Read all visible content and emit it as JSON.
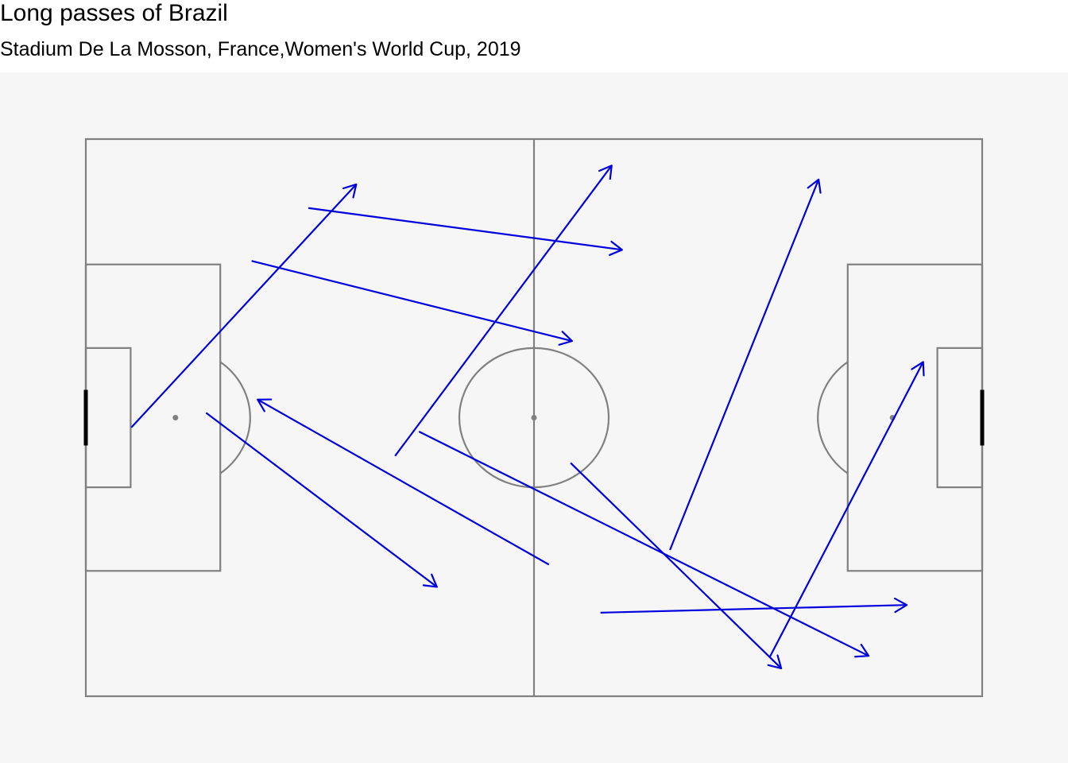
{
  "chart_data": {
    "type": "pass-map",
    "title": "Long passes of Brazil",
    "subtitle": "Stadium De La Mosson, France,Women's World Cup, 2019",
    "pitch": {
      "length": 120,
      "width": 80,
      "line_color": "#808080",
      "background": "#f6f6f6",
      "goal_color": "#000000"
    },
    "arrow_color": "#0000dd",
    "passes": [
      {
        "x": 6.1,
        "y": 41.4,
        "end_x": 36.2,
        "end_y": 6.5
      },
      {
        "x": 29.8,
        "y": 9.9,
        "end_x": 71.8,
        "end_y": 15.9
      },
      {
        "x": 22.2,
        "y": 17.5,
        "end_x": 65.1,
        "end_y": 29.0
      },
      {
        "x": 16.1,
        "y": 39.3,
        "end_x": 47.0,
        "end_y": 64.3
      },
      {
        "x": 41.4,
        "y": 45.5,
        "end_x": 70.4,
        "end_y": 3.8
      },
      {
        "x": 62.0,
        "y": 61.1,
        "end_x": 23.0,
        "end_y": 37.4
      },
      {
        "x": 44.6,
        "y": 42.0,
        "end_x": 104.8,
        "end_y": 74.2
      },
      {
        "x": 64.9,
        "y": 46.5,
        "end_x": 93.1,
        "end_y": 76.0
      },
      {
        "x": 78.2,
        "y": 59.0,
        "end_x": 98.1,
        "end_y": 5.8
      },
      {
        "x": 68.9,
        "y": 68.0,
        "end_x": 109.9,
        "end_y": 66.9
      },
      {
        "x": 91.6,
        "y": 74.3,
        "end_x": 112.1,
        "end_y": 32.0
      }
    ]
  }
}
